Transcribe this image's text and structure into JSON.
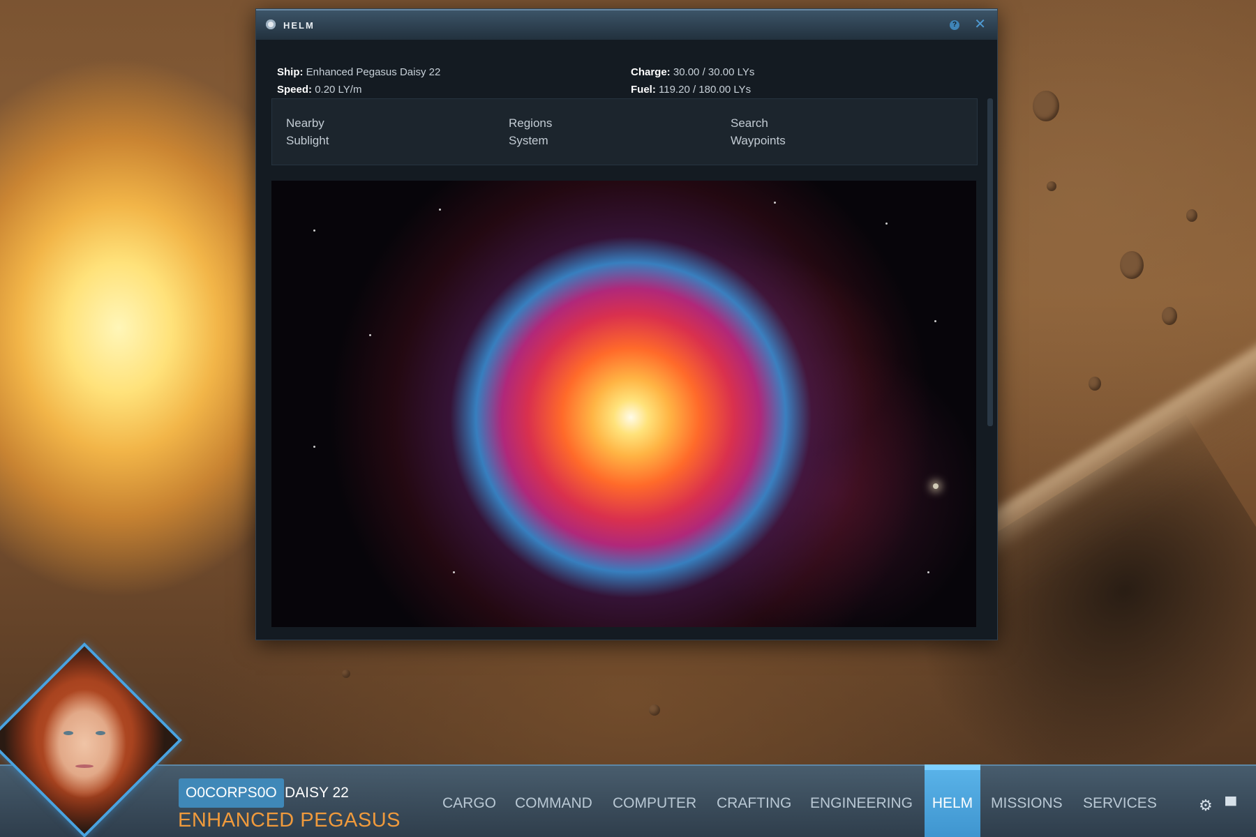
{
  "window": {
    "title": "HELM",
    "help_icon": "help-icon",
    "close_icon": "close-icon"
  },
  "ship_info": {
    "ship_label": "Ship:",
    "ship_value": "Enhanced Pegasus Daisy 22",
    "speed_label": "Speed:",
    "speed_value": "0.20 LY/m",
    "charge_label": "Charge:",
    "charge_value": "30.00 / 30.00 LYs",
    "fuel_label": "Fuel:",
    "fuel_value": "119.20 / 180.00 LYs"
  },
  "nav": [
    [
      "Nearby",
      "Sublight"
    ],
    [
      "Regions",
      "System"
    ],
    [
      "Search",
      "Waypoints"
    ]
  ],
  "pilot": {
    "corp": "O0CORPS0O",
    "name": "DAISY 22",
    "ship": "ENHANCED PEGASUS"
  },
  "menu": [
    {
      "label": "CARGO",
      "active": false
    },
    {
      "label": "COMMAND",
      "active": false
    },
    {
      "label": "COMPUTER",
      "active": false
    },
    {
      "label": "CRAFTING",
      "active": false
    },
    {
      "label": "ENGINEERING",
      "active": false
    },
    {
      "label": "HELM",
      "active": true
    },
    {
      "label": "MISSIONS",
      "active": false
    },
    {
      "label": "SERVICES",
      "active": false
    }
  ],
  "colors": {
    "accent": "#4aa3e0",
    "ship_name": "#f09a3c",
    "window_bg": "#141b22"
  }
}
